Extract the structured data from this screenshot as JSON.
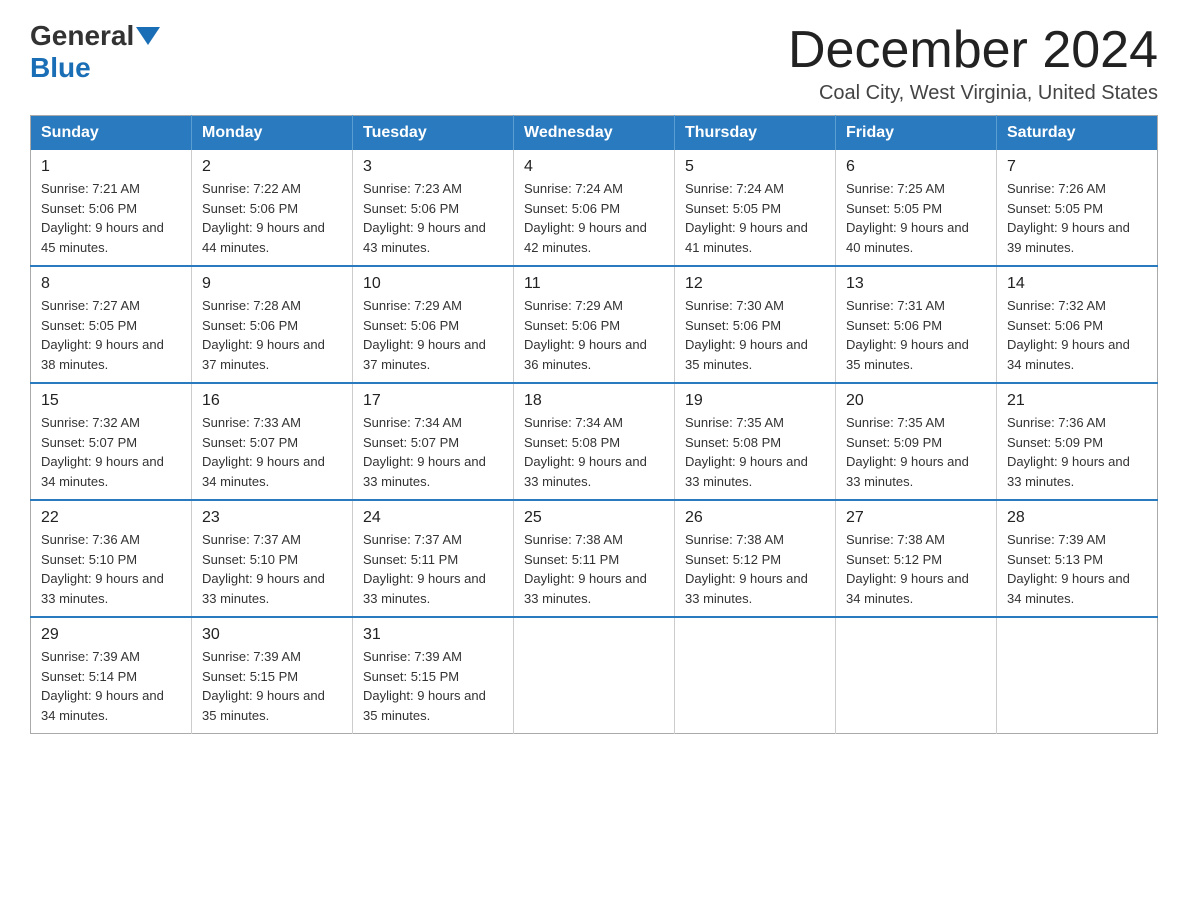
{
  "logo": {
    "general": "General",
    "blue": "Blue"
  },
  "header": {
    "month_year": "December 2024",
    "location": "Coal City, West Virginia, United States"
  },
  "days_of_week": [
    "Sunday",
    "Monday",
    "Tuesday",
    "Wednesday",
    "Thursday",
    "Friday",
    "Saturday"
  ],
  "weeks": [
    [
      {
        "day": "1",
        "sunrise": "Sunrise: 7:21 AM",
        "sunset": "Sunset: 5:06 PM",
        "daylight": "Daylight: 9 hours and 45 minutes."
      },
      {
        "day": "2",
        "sunrise": "Sunrise: 7:22 AM",
        "sunset": "Sunset: 5:06 PM",
        "daylight": "Daylight: 9 hours and 44 minutes."
      },
      {
        "day": "3",
        "sunrise": "Sunrise: 7:23 AM",
        "sunset": "Sunset: 5:06 PM",
        "daylight": "Daylight: 9 hours and 43 minutes."
      },
      {
        "day": "4",
        "sunrise": "Sunrise: 7:24 AM",
        "sunset": "Sunset: 5:06 PM",
        "daylight": "Daylight: 9 hours and 42 minutes."
      },
      {
        "day": "5",
        "sunrise": "Sunrise: 7:24 AM",
        "sunset": "Sunset: 5:05 PM",
        "daylight": "Daylight: 9 hours and 41 minutes."
      },
      {
        "day": "6",
        "sunrise": "Sunrise: 7:25 AM",
        "sunset": "Sunset: 5:05 PM",
        "daylight": "Daylight: 9 hours and 40 minutes."
      },
      {
        "day": "7",
        "sunrise": "Sunrise: 7:26 AM",
        "sunset": "Sunset: 5:05 PM",
        "daylight": "Daylight: 9 hours and 39 minutes."
      }
    ],
    [
      {
        "day": "8",
        "sunrise": "Sunrise: 7:27 AM",
        "sunset": "Sunset: 5:05 PM",
        "daylight": "Daylight: 9 hours and 38 minutes."
      },
      {
        "day": "9",
        "sunrise": "Sunrise: 7:28 AM",
        "sunset": "Sunset: 5:06 PM",
        "daylight": "Daylight: 9 hours and 37 minutes."
      },
      {
        "day": "10",
        "sunrise": "Sunrise: 7:29 AM",
        "sunset": "Sunset: 5:06 PM",
        "daylight": "Daylight: 9 hours and 37 minutes."
      },
      {
        "day": "11",
        "sunrise": "Sunrise: 7:29 AM",
        "sunset": "Sunset: 5:06 PM",
        "daylight": "Daylight: 9 hours and 36 minutes."
      },
      {
        "day": "12",
        "sunrise": "Sunrise: 7:30 AM",
        "sunset": "Sunset: 5:06 PM",
        "daylight": "Daylight: 9 hours and 35 minutes."
      },
      {
        "day": "13",
        "sunrise": "Sunrise: 7:31 AM",
        "sunset": "Sunset: 5:06 PM",
        "daylight": "Daylight: 9 hours and 35 minutes."
      },
      {
        "day": "14",
        "sunrise": "Sunrise: 7:32 AM",
        "sunset": "Sunset: 5:06 PM",
        "daylight": "Daylight: 9 hours and 34 minutes."
      }
    ],
    [
      {
        "day": "15",
        "sunrise": "Sunrise: 7:32 AM",
        "sunset": "Sunset: 5:07 PM",
        "daylight": "Daylight: 9 hours and 34 minutes."
      },
      {
        "day": "16",
        "sunrise": "Sunrise: 7:33 AM",
        "sunset": "Sunset: 5:07 PM",
        "daylight": "Daylight: 9 hours and 34 minutes."
      },
      {
        "day": "17",
        "sunrise": "Sunrise: 7:34 AM",
        "sunset": "Sunset: 5:07 PM",
        "daylight": "Daylight: 9 hours and 33 minutes."
      },
      {
        "day": "18",
        "sunrise": "Sunrise: 7:34 AM",
        "sunset": "Sunset: 5:08 PM",
        "daylight": "Daylight: 9 hours and 33 minutes."
      },
      {
        "day": "19",
        "sunrise": "Sunrise: 7:35 AM",
        "sunset": "Sunset: 5:08 PM",
        "daylight": "Daylight: 9 hours and 33 minutes."
      },
      {
        "day": "20",
        "sunrise": "Sunrise: 7:35 AM",
        "sunset": "Sunset: 5:09 PM",
        "daylight": "Daylight: 9 hours and 33 minutes."
      },
      {
        "day": "21",
        "sunrise": "Sunrise: 7:36 AM",
        "sunset": "Sunset: 5:09 PM",
        "daylight": "Daylight: 9 hours and 33 minutes."
      }
    ],
    [
      {
        "day": "22",
        "sunrise": "Sunrise: 7:36 AM",
        "sunset": "Sunset: 5:10 PM",
        "daylight": "Daylight: 9 hours and 33 minutes."
      },
      {
        "day": "23",
        "sunrise": "Sunrise: 7:37 AM",
        "sunset": "Sunset: 5:10 PM",
        "daylight": "Daylight: 9 hours and 33 minutes."
      },
      {
        "day": "24",
        "sunrise": "Sunrise: 7:37 AM",
        "sunset": "Sunset: 5:11 PM",
        "daylight": "Daylight: 9 hours and 33 minutes."
      },
      {
        "day": "25",
        "sunrise": "Sunrise: 7:38 AM",
        "sunset": "Sunset: 5:11 PM",
        "daylight": "Daylight: 9 hours and 33 minutes."
      },
      {
        "day": "26",
        "sunrise": "Sunrise: 7:38 AM",
        "sunset": "Sunset: 5:12 PM",
        "daylight": "Daylight: 9 hours and 33 minutes."
      },
      {
        "day": "27",
        "sunrise": "Sunrise: 7:38 AM",
        "sunset": "Sunset: 5:12 PM",
        "daylight": "Daylight: 9 hours and 34 minutes."
      },
      {
        "day": "28",
        "sunrise": "Sunrise: 7:39 AM",
        "sunset": "Sunset: 5:13 PM",
        "daylight": "Daylight: 9 hours and 34 minutes."
      }
    ],
    [
      {
        "day": "29",
        "sunrise": "Sunrise: 7:39 AM",
        "sunset": "Sunset: 5:14 PM",
        "daylight": "Daylight: 9 hours and 34 minutes."
      },
      {
        "day": "30",
        "sunrise": "Sunrise: 7:39 AM",
        "sunset": "Sunset: 5:15 PM",
        "daylight": "Daylight: 9 hours and 35 minutes."
      },
      {
        "day": "31",
        "sunrise": "Sunrise: 7:39 AM",
        "sunset": "Sunset: 5:15 PM",
        "daylight": "Daylight: 9 hours and 35 minutes."
      },
      null,
      null,
      null,
      null
    ]
  ]
}
